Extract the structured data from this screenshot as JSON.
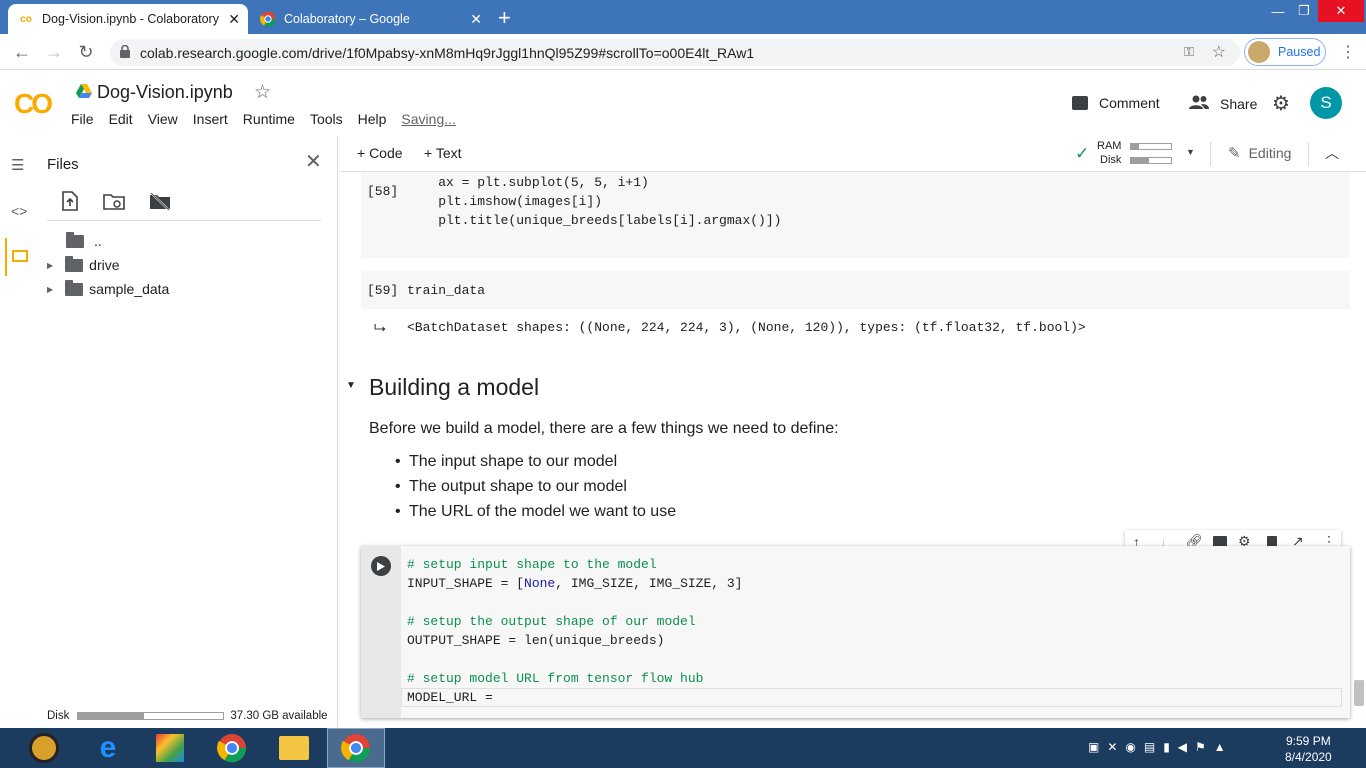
{
  "browser": {
    "tabs": [
      {
        "title": "Dog-Vision.ipynb - Colaboratory",
        "active": true
      },
      {
        "title": "Colaboratory – Google",
        "active": false
      }
    ],
    "url": "colab.research.google.com/drive/1f0Mpabsy-xnM8mHq9rJggl1hnQl95Z99#scrollTo=o00E4lt_RAw1",
    "profile_status": "Paused"
  },
  "colab": {
    "logo": "CO",
    "notebook_title": "Dog-Vision.ipynb",
    "menus": [
      "File",
      "Edit",
      "View",
      "Insert",
      "Runtime",
      "Tools",
      "Help"
    ],
    "saving_status": "Saving...",
    "comment_label": "Comment",
    "share_label": "Share",
    "avatar_letter": "S"
  },
  "sidebar": {
    "title": "Files",
    "tree": [
      {
        "label": ".."
      },
      {
        "label": "drive"
      },
      {
        "label": "sample_data"
      }
    ],
    "disk_label": "Disk",
    "disk_available": "37.30 GB available",
    "disk_used_fraction": 0.45
  },
  "toolbar": {
    "add_code": "+ Code",
    "add_text": "+ Text",
    "ram_label": "RAM",
    "disk_label": "Disk",
    "editing_label": "Editing"
  },
  "cells": {
    "cell58": {
      "prompt": "[58]",
      "lines": [
        "    ax = plt.subplot(5, 5, i+1)",
        "    plt.imshow(images[i])",
        "    plt.title(unique_breeds[labels[i].argmax()])"
      ]
    },
    "cell59": {
      "prompt": "[59]",
      "code": "train_data",
      "output": "<BatchDataset shapes: ((None, 224, 224, 3), (None, 120)), types: (tf.float32, tf.bool)>"
    },
    "markdown": {
      "heading": "Building a model",
      "intro": "Before we build a model, there are a few things we need to define:",
      "bullets": [
        "The input shape to our model",
        "The output shape to our model",
        "The URL of the model we want to use"
      ]
    },
    "active_cell": {
      "comment1": "# setup input shape to the model",
      "line1_prefix": "INPUT_SHAPE = [",
      "line1_none": "None",
      "line1_suffix": ", IMG_SIZE, IMG_SIZE, 3]",
      "comment2": "# setup the output shape of our model",
      "line2": "OUTPUT_SHAPE = len(unique_breeds)",
      "comment3": "# setup model URL from tensor flow hub",
      "line3": "MODEL_URL = "
    }
  },
  "taskbar": {
    "time": "9:59 PM",
    "date": "8/4/2020"
  }
}
